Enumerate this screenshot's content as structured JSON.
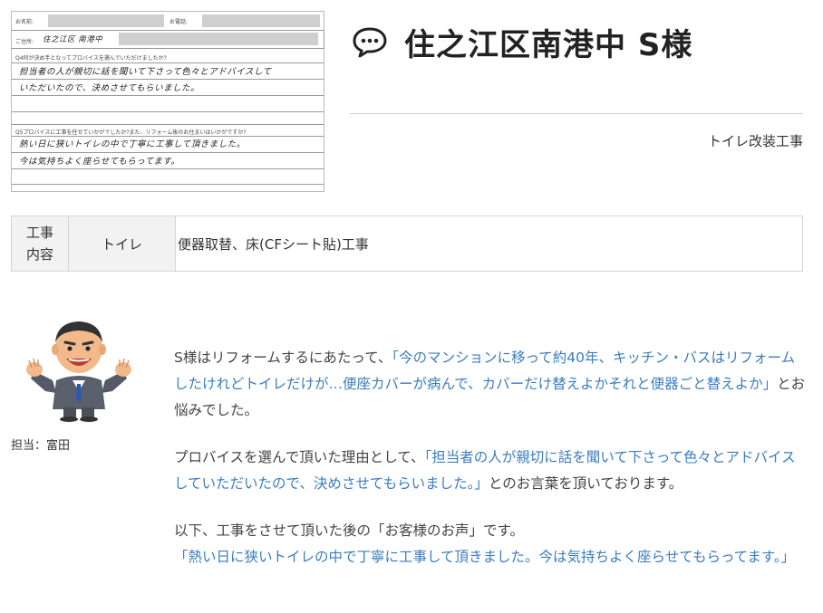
{
  "form": {
    "name_label": "お名前:",
    "phone_label": "お電話:",
    "address_label": "ご住所:",
    "address_value": "住之江区 南港中",
    "q4": "Q4何が決め手となってプロバイスを選んでいただけましたか?",
    "q4_answer_line1": "担当者の人が親切に話を聞いて下さって色々とアドバイスして",
    "q4_answer_line2": "いただいたので、決めさせてもらいました。",
    "q5": "Q5プロバイスに工事を任せていかがでしたか?また、リフォーム後のお住まいはいかがですか?",
    "q5_answer_line1": "熱い日に狭いトイレの中で丁寧に工事して頂きました。",
    "q5_answer_line2": "今は気持ちよく座らせてもらってます。"
  },
  "header": {
    "title": "住之江区南港中 S様",
    "icon": "speech-bubble-icon",
    "work_type": "トイレ改装工事"
  },
  "table": {
    "label": "工事内容",
    "label_line1": "工事",
    "label_line2": "内容",
    "category": "トイレ",
    "detail": "便器取替、床(CFシート貼)工事"
  },
  "staff": {
    "label": "担当：富田"
  },
  "body": {
    "p1_pre": "S様はリフォームするにあたって、",
    "p1_quote": "「今のマンションに移って約40年、キッチン・バスはリフォームしたけれどトイレだけが…便座カバーが病んで、カバーだけ替えよかそれと便器ごと替えよか」",
    "p1_post": "とお悩みでした。",
    "p2_pre": "プロバイスを選んで頂いた理由として、",
    "p2_quote": "「担当者の人が親切に話を聞いて下さって色々とアドバイスしていただいたので、決めさせてもらいました。」",
    "p2_post": "とのお言葉を頂いております。",
    "p3_line": "以下、工事をさせて頂いた後の「お客様のお声」です。",
    "p3_quote": "「熱い日に狭いトイレの中で丁寧に工事して頂きました。今は気持ちよく座らせてもらってます。」"
  },
  "colors": {
    "quote": "#3a7dc1",
    "text": "#444444",
    "table_header_bg": "#f2f2f2"
  }
}
